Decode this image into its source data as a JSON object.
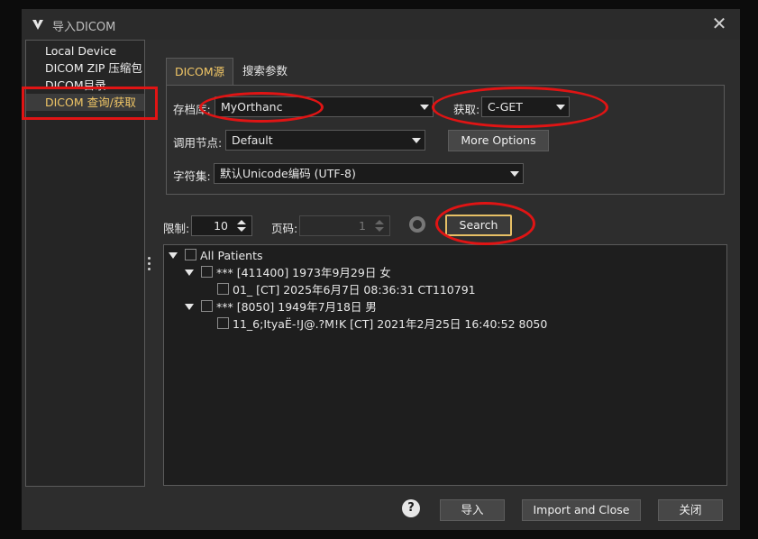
{
  "window": {
    "title": "导入DICOM",
    "close_icon": "close-icon"
  },
  "sidebar": {
    "items": [
      "Local Device",
      "DICOM ZIP 压缩包",
      "DICOM目录",
      "DICOM 查询/获取"
    ],
    "active": 3
  },
  "tabs": [
    "DICOM源",
    "搜索参数"
  ],
  "source": {
    "archive_label": "存档库:",
    "archive_value": "MyOrthanc",
    "retrieve_label": "获取:",
    "retrieve_value": "C-GET",
    "calling_node_label": "调用节点:",
    "calling_node_value": "Default",
    "more_options": "More Options",
    "charset_label": "字符集:",
    "charset_value": "默认Unicode编码 (UTF-8)"
  },
  "query": {
    "limit_label": "限制:",
    "limit_value": "10",
    "page_label": "页码:",
    "page_value": "1",
    "search": "Search"
  },
  "tree": {
    "root": "All Patients",
    "patients": [
      {
        "label": "*** [411400] 1973年9月29日 女",
        "studies": [
          "01_ [CT] 2025年6月7日 08:36:31 CT110791"
        ]
      },
      {
        "label": "*** [8050] 1949年7月18日 男",
        "studies": [
          "11_6;ItyaË-!J@.?M!K [CT] 2021年2月25日 16:40:52 8050"
        ]
      }
    ]
  },
  "footer": {
    "help": "?",
    "import": "导入",
    "import_close": "Import and Close",
    "close": "关闭"
  },
  "colors": {
    "accent": "#f2c766",
    "annotation": "#e01414"
  }
}
